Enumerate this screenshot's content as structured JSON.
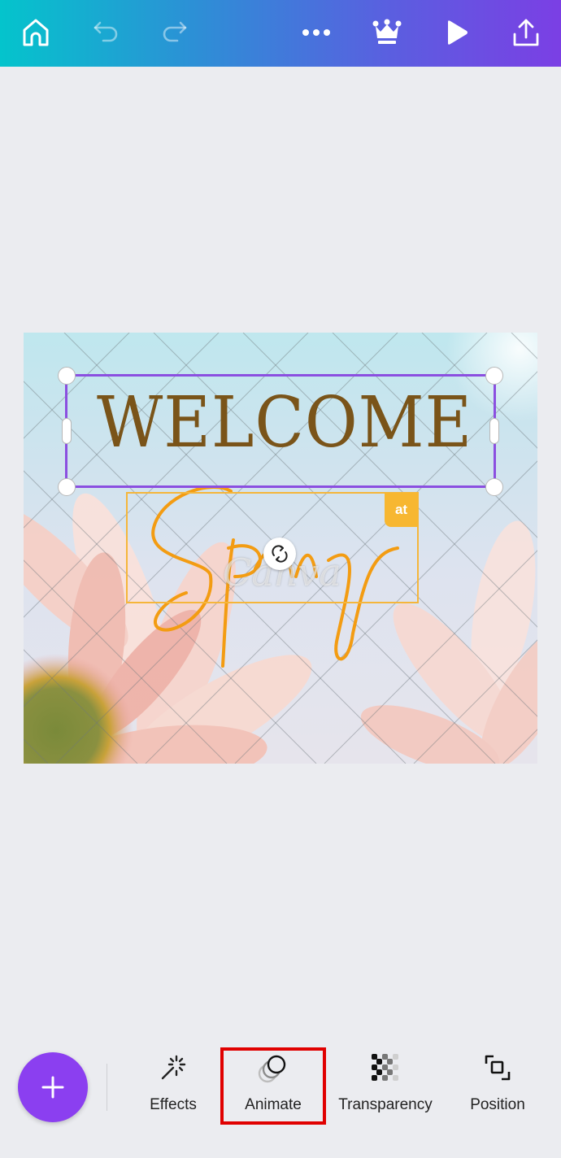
{
  "topbar": {
    "icons": [
      "home-icon",
      "undo-icon",
      "redo-icon",
      "more-icon",
      "crown-icon",
      "play-icon",
      "share-icon"
    ],
    "undo_enabled": false,
    "redo_enabled": false,
    "gradient_colors": [
      "#04c4cc",
      "#7b3fe4"
    ]
  },
  "design": {
    "heading": "WELCOME",
    "script_text": "Spring",
    "badge_text": "at",
    "watermark": "Canva",
    "heading_color": "#7a5419",
    "script_color": "#f39c12",
    "selection_color": "#8b4fe0"
  },
  "toolbar": {
    "add_button": "+",
    "tools": [
      {
        "label": "Effects",
        "icon": "magic-wand-icon"
      },
      {
        "label": "Animate",
        "icon": "animate-icon",
        "highlighted": true
      },
      {
        "label": "Transparency",
        "icon": "transparency-icon"
      },
      {
        "label": "Position",
        "icon": "position-icon"
      }
    ]
  }
}
